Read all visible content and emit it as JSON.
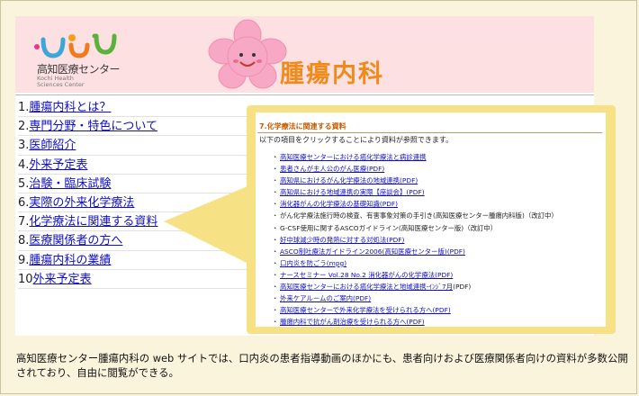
{
  "header": {
    "logo_name": "高知医療センター",
    "logo_en_line1": "Kochi Health",
    "logo_en_line2": "Sciences Center",
    "department_title": "腫瘍内科"
  },
  "nav": {
    "items": [
      {
        "num": "1.",
        "label": "腫瘍内科とは？"
      },
      {
        "num": "2.",
        "label": "専門分野・特色について"
      },
      {
        "num": "3.",
        "label": "医師紹介"
      },
      {
        "num": "4.",
        "label": "外来予定表"
      },
      {
        "num": "5.",
        "label": "治験・臨床試験"
      },
      {
        "num": "6.",
        "label": "実際の外来化学療法"
      },
      {
        "num": "7.",
        "label": "化学療法に関連する資料"
      },
      {
        "num": "8.",
        "label": "医療関係者の方へ"
      },
      {
        "num": "9.",
        "label": "腫瘍内科の業績"
      },
      {
        "num": "10",
        "label": "外来予定表"
      }
    ]
  },
  "panel": {
    "heading": "7.化学療法に関連する資料",
    "intro": "以下の項目をクリックすることにより資料が参照できます。",
    "bullet": "・",
    "items": [
      {
        "text": "高知医療センターにおける癌化学療法と病診連携",
        "link": true,
        "suffix": ""
      },
      {
        "text": "患者さんが主人公のがん医療(PDF)",
        "link": true,
        "suffix": ""
      },
      {
        "text": "高知県におけるがん化学療法の地域連携(PDF)",
        "link": true,
        "suffix": ""
      },
      {
        "text": "高知県における地域連携の実際【座談会】(PDF)",
        "link": true,
        "suffix": ""
      },
      {
        "text": "消化器がんの化学療法の基礎知識(PDF)",
        "link": true,
        "suffix": ""
      },
      {
        "text": "がん化学療法施行時の検査、有害事象対策の手引き(高知医療センター腫瘍内科版)（改訂中）",
        "link": false,
        "suffix": ""
      },
      {
        "text": "G-CSF使用に関するASCOガイドライン(高知医療センター版)（改訂中）",
        "link": false,
        "suffix": ""
      },
      {
        "text": "好中球減少時の発熱に対する対処法(PDF)",
        "link": true,
        "suffix": ""
      },
      {
        "text": "ASCO制吐療法ガイドライン2006(高知医療センター版)(PDF)",
        "link": true,
        "suffix": ""
      },
      {
        "text": "口内炎を防ごう(mpg)",
        "link": true,
        "suffix": ""
      },
      {
        "text": "ナースセミナー Vol.28 No.2 消化器がんの化学療法(PDF)",
        "link": true,
        "suffix": ""
      },
      {
        "text": "高知医療センターにおける癌化学療法と地域連携-ｲﾝｼﾞ7月",
        "link": true,
        "suffix": "(PDF)"
      },
      {
        "text": "外来ケアルームのご案内(PDF)",
        "link": true,
        "suffix": ""
      },
      {
        "text": "高知医療センターで外来化学療法を受けられる方へ(PDF)",
        "link": true,
        "suffix": ""
      },
      {
        "text": "腫瘍内科で抗がん剤治療を受けられる方へ(PDF)",
        "link": true,
        "suffix": ""
      }
    ]
  },
  "caption": "高知医療センター腫瘍内科の web サイトでは、口内炎の患者指導動画のほかにも、患者向けおよび医療関係者向けの資料が多数公開されており、自由に閲覧ができる。",
  "colors": {
    "banner_bg": "#fde0e2",
    "title_orange": "#f08a1a",
    "link_blue": "#1010c0",
    "panel_yellow": "#f7e185",
    "page_bg": "#fbf4dc"
  },
  "icons": {
    "logo": "kochi-health-logo",
    "mascot": "cherry-blossom-mascot-icon"
  }
}
